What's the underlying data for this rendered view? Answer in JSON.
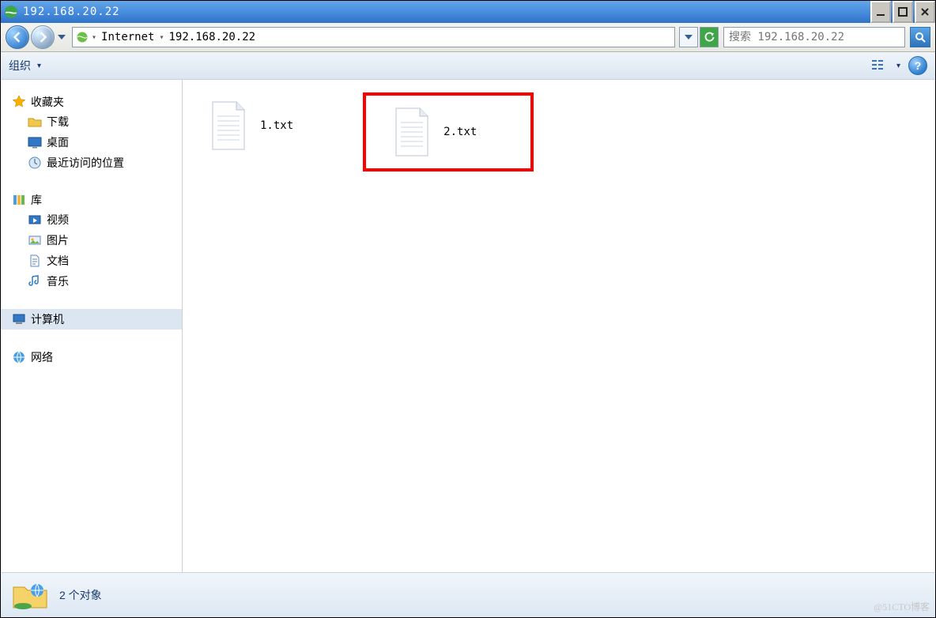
{
  "titlebar": {
    "title": "192.168.20.22"
  },
  "address": {
    "root": "Internet",
    "path": "192.168.20.22"
  },
  "search": {
    "placeholder": "搜索 192.168.20.22"
  },
  "toolbar": {
    "organize": "组织"
  },
  "sidebar": {
    "favorites": {
      "label": "收藏夹"
    },
    "downloads": {
      "label": "下载"
    },
    "desktop": {
      "label": "桌面"
    },
    "recent": {
      "label": "最近访问的位置"
    },
    "libraries": {
      "label": "库"
    },
    "video": {
      "label": "视频"
    },
    "pictures": {
      "label": "图片"
    },
    "documents": {
      "label": "文档"
    },
    "music": {
      "label": "音乐"
    },
    "computer": {
      "label": "计算机"
    },
    "network": {
      "label": "网络"
    }
  },
  "files": {
    "f1": {
      "name": "1.txt"
    },
    "f2": {
      "name": "2.txt"
    }
  },
  "status": {
    "count_text": "2 个对象"
  },
  "watermark": "@51CTO博客"
}
